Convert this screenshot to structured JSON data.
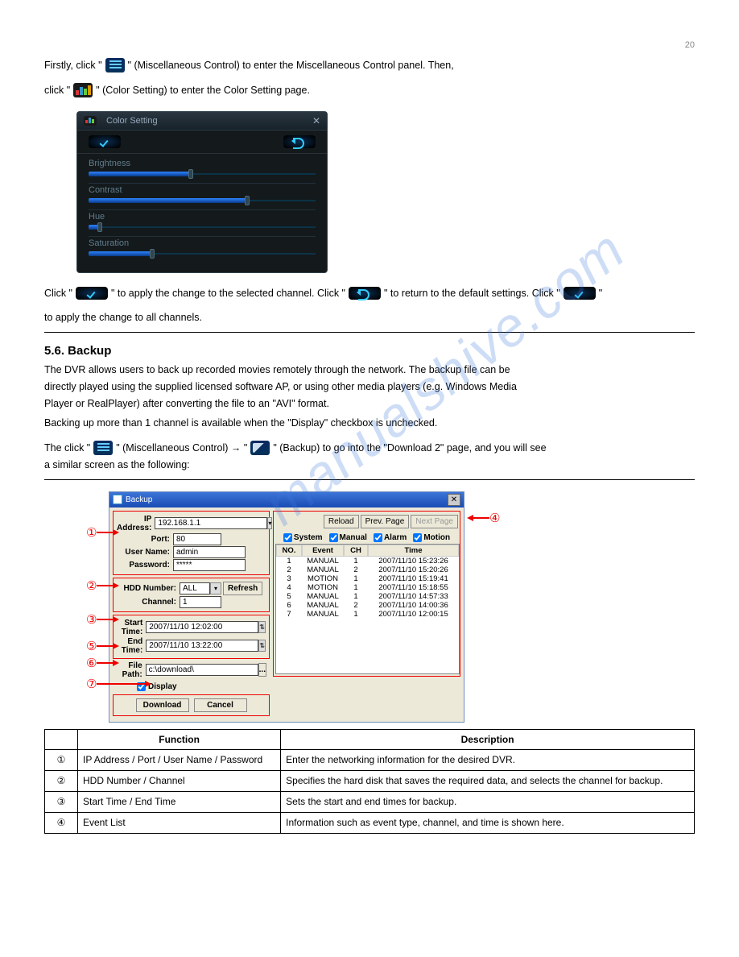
{
  "page_num": "20",
  "intro": {
    "p1a": "Firstly, click \"",
    "p1b": "\" (Miscellaneous Control) to enter the Miscellaneous Control panel. Then,",
    "p1c": "click \"",
    "p1d": "\" (Color Setting) to enter the Color Setting page."
  },
  "color_panel": {
    "title": "Color Setting",
    "items": {
      "brightness": "Brightness",
      "contrast": "Contrast",
      "hue": "Hue",
      "saturation": "Saturation"
    }
  },
  "after_color": {
    "p1a": "Click \"",
    "p1b": "\" to apply the change to the selected channel. Click \"",
    "p1c": "\" to return to the default settings. Click \"",
    "p1d": "\"",
    "p2": "to apply the change to all channels."
  },
  "section": "5.6. Backup",
  "backup_intro": {
    "p1": "The DVR allows users to back up recorded movies remotely through the network. The backup file can be",
    "p2": "directly played using the supplied licensed software AP, or using other media players (e.g. Windows Media",
    "p3": "Player or RealPlayer) after converting the file to an \"AVI\" format.",
    "p4": "Backing up more than 1 channel is available when the \"Display\" checkbox is unchecked.",
    "p5a": "The click \"",
    "p5b": "\" (Miscellaneous Control) → \"",
    "p5c": "\" (Backup) to go into the \"Download 2\" page, and you will see",
    "p6": "a similar screen as the following:"
  },
  "backup_dialog": {
    "title": "Backup",
    "labels": {
      "ip": "IP Address:",
      "port": "Port:",
      "user": "User Name:",
      "pw": "Password:",
      "hdd": "HDD Number:",
      "ch": "Channel:",
      "st": "Start Time:",
      "et": "End Time:",
      "fp": "File Path:",
      "disp": "Display"
    },
    "values": {
      "ip": "192.168.1.1",
      "port": "80",
      "user": "admin",
      "pw": "*****",
      "hdd": "ALL",
      "ch": "1",
      "st": "2007/11/10 12:02:00",
      "et": "2007/11/10 13:22:00",
      "fp": "c:\\download\\"
    },
    "buttons": {
      "refresh": "Refresh",
      "download": "Download",
      "cancel": "Cancel",
      "reload": "Reload",
      "prev": "Prev. Page",
      "next": "Next Page"
    },
    "checks": {
      "system": "System",
      "manual": "Manual",
      "alarm": "Alarm",
      "motion": "Motion"
    },
    "table": {
      "head": {
        "no": "NO.",
        "event": "Event",
        "ch": "CH",
        "time": "Time"
      },
      "rows": [
        {
          "no": "1",
          "event": "MANUAL",
          "ch": "1",
          "time": "2007/11/10 15:23:26"
        },
        {
          "no": "2",
          "event": "MANUAL",
          "ch": "2",
          "time": "2007/11/10 15:20:26"
        },
        {
          "no": "3",
          "event": "MOTION",
          "ch": "1",
          "time": "2007/11/10 15:19:41"
        },
        {
          "no": "4",
          "event": "MOTION",
          "ch": "1",
          "time": "2007/11/10 15:18:55"
        },
        {
          "no": "5",
          "event": "MANUAL",
          "ch": "1",
          "time": "2007/11/10 14:57:33"
        },
        {
          "no": "6",
          "event": "MANUAL",
          "ch": "2",
          "time": "2007/11/10 14:00:36"
        },
        {
          "no": "7",
          "event": "MANUAL",
          "ch": "1",
          "time": "2007/11/10 12:00:15"
        }
      ]
    }
  },
  "callouts": {
    "c1": "①",
    "c2": "②",
    "c3": "③",
    "c4": "④",
    "c5": "⑤",
    "c6": "⑥",
    "c7": "⑦"
  },
  "desc_table": {
    "head": {
      "func": "Function",
      "desc": "Description"
    },
    "rows": [
      {
        "n": "①",
        "func": "IP Address / Port / User Name / Password",
        "desc": "Enter the networking information for the desired DVR."
      },
      {
        "n": "②",
        "func": "HDD Number / Channel",
        "desc": "Specifies the hard disk that saves the required data, and selects the channel for backup."
      },
      {
        "n": "③",
        "func": "Start Time / End Time",
        "desc": "Sets the start and end times for backup."
      },
      {
        "n": "④",
        "func": "Event List",
        "desc": "Information such as event type, channel, and time is shown here."
      }
    ]
  }
}
